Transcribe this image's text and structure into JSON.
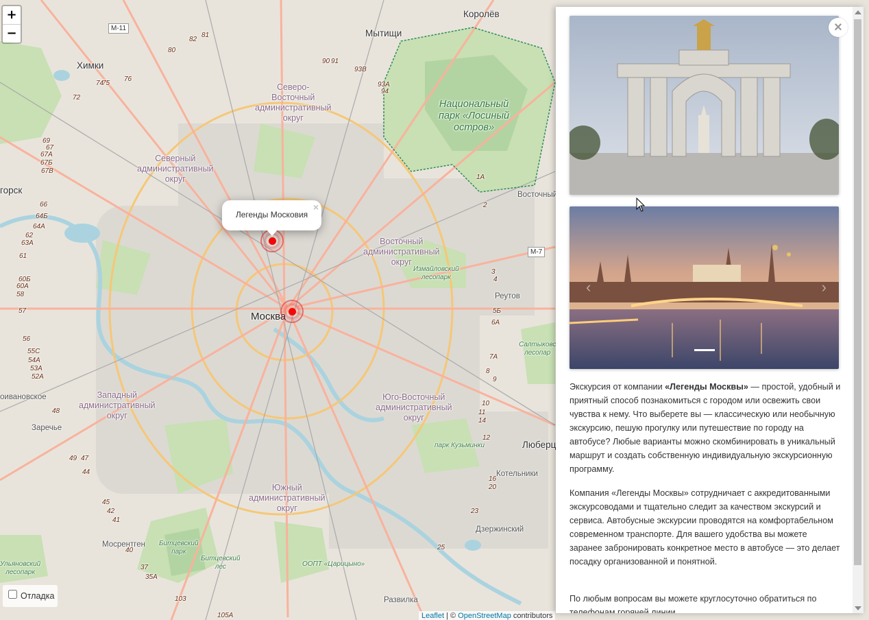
{
  "map": {
    "zoom_in": "+",
    "zoom_out": "−",
    "labels": {
      "korolev": "Королёв",
      "mytishchi": "Мытищи",
      "khimki": "Химки",
      "moskva": "Москва",
      "vostochny": "Восточный",
      "reutov": "Реутов",
      "lyubertsy": "Люберц",
      "kotelniki": "Котельники",
      "dzerzhinsky": "Дзержинский",
      "razvilka": "Развилка",
      "mosrentgen": "Мосрентген",
      "zarechye": "Заречье",
      "krasnogorsk": "горск",
      "odintsovo": "оивановское",
      "sev_vost_okrug": "Северо-\nВосточный\nадминистративный\nокруг",
      "sev_okrug": "Северный\nадминистративный\nокруг",
      "vost_okrug": "Восточный\nадминистративный\nокруг",
      "zap_okrug": "Западный\nадминистративный\nокруг",
      "yug_vost_okrug": "Юго-Восточный\nадминистративный\nокруг",
      "yuzh_okrug": "Южный\nадминистративный\nокруг",
      "losiny": "Национальный\nпарк «Лосиный\nостров»",
      "izmailovsky": "Измайловский\nлесопарк",
      "kuzminki": "парк Кузьминки",
      "bitsevsky": "Битцевский\nпарк",
      "bitsevsky_les": "Битцевский\nлес",
      "tsaritsyno": "ООПТ «Царицыно»",
      "saltykovsky": "Салтыковс\nлесопар",
      "ulyanovsky": "Ульяновский\nлесопарк",
      "moskva_river": "Москва"
    },
    "shields": {
      "m11": "М-11",
      "m7": "М-7"
    },
    "road_numbers": [
      "82",
      "81",
      "80",
      "76",
      "75",
      "74",
      "72",
      "90",
      "91",
      "93В",
      "93А",
      "94",
      "69",
      "67",
      "67А",
      "67Б",
      "67В",
      "66",
      "64Б",
      "64А",
      "62",
      "63А",
      "61",
      "60Б",
      "60А",
      "58",
      "57",
      "56",
      "55С",
      "54А",
      "53А",
      "52А",
      "48",
      "49",
      "47",
      "44",
      "45",
      "42",
      "41",
      "40",
      "37",
      "35А",
      "103",
      "105А",
      "1А",
      "2",
      "3",
      "4",
      "5Б",
      "6А",
      "7А",
      "8",
      "9",
      "10",
      "11",
      "14",
      "12",
      "16",
      "20",
      "23",
      "25"
    ]
  },
  "popup": {
    "title": "Легенды Московия",
    "close": "×"
  },
  "debug": {
    "label": "Отладка",
    "checked": false
  },
  "attribution": {
    "leaflet": "Leaflet",
    "separator": " | © ",
    "osm": "OpenStreetMap",
    "contributors": " contributors"
  },
  "panel": {
    "close": "×",
    "carousel_active_index": 0,
    "paragraph1_prefix": "Экскурсия от компании ",
    "paragraph1_bold": "«Легенды Москвы»",
    "paragraph1_rest": " — простой, удобный и приятный способ познакомиться с городом или освежить свои чувства к нему. Что выберете вы — классическую или необычную экскурсию, пешую прогулку или путешествие по городу на автобусе? Любые варианты можно скомбинировать в уникальный маршрут и создать собственную индивидуальную экскурсионную программу.",
    "paragraph2": "Компания «Легенды Москвы» сотрудничает с аккредитованными экскурсоводами и тщательно следит за качеством экскурсий и сервиса. Автобусные экскурсии проводятся на комфортабельном современном транспорте. Для вашего удобства вы можете заранее забронировать конкретное место в автобусе — это делает посадку организованной и понятной.",
    "paragraph3": "По любым вопросам вы можете круглосуточно обратиться по телефонам горячей линии"
  },
  "colors": {
    "marker": "#f20a0a",
    "park": "#c8e0b4",
    "forest": "#add19e",
    "water": "#aad3df",
    "road_major": "#f6c776",
    "road_trunk": "#f9b29c",
    "link": "#0078a8"
  }
}
